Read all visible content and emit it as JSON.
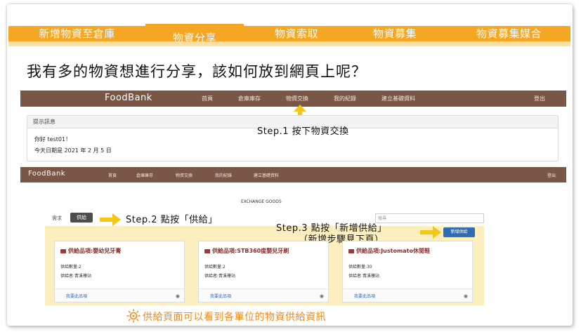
{
  "tabs": [
    {
      "label": "新增物資至倉庫"
    },
    {
      "label": "物資分享"
    },
    {
      "label": "物資索取"
    },
    {
      "label": "物資募集"
    },
    {
      "label": "物資募集媒合"
    }
  ],
  "question": "我有多的物資想進行分享，該如何放到網頁上呢？",
  "screen1": {
    "brand": "FoodBank",
    "nav": [
      "首頁",
      "倉庫庫存",
      "物資交換",
      "我的紀錄",
      "建立基礎資料"
    ],
    "logout": "登出",
    "alert_header": "提示訊息",
    "greeting": "你好 test01！",
    "date_line": "今天日期是 2021 年 2 月 5 日"
  },
  "step1": "Step.1 按下物資交換",
  "screen2": {
    "brand": "FoodBank",
    "nav": [
      "首頁",
      "倉庫庫存",
      "物資交換",
      "我的紀錄",
      "建立基礎資料"
    ],
    "logout": "登出",
    "section_title": "EXCHANGE GOODS",
    "pill_need": "需求",
    "pill_supply": "供給",
    "search_placeholder": "搜尋",
    "add_button": "新增供給",
    "cards": [
      {
        "title": "供給品項:嬰幼兒牙膏",
        "qty": "供給數量:2",
        "provider": "供給者:青溪樓站",
        "want": "我要此品項"
      },
      {
        "title": "供給品項:STB360度嬰兒牙刷",
        "qty": "供給數量:2",
        "provider": "供給者:青溪樓站",
        "want": "我要此品項"
      },
      {
        "title": "供給品項:Justomato休閒鞋",
        "qty": "供給數量:30",
        "provider": "供給者:青溪樓站",
        "want": "我要此品項"
      }
    ]
  },
  "step2": "Step.2 點按「供給」",
  "step3": "Step.3 點按「新增供給」",
  "step3_note": "（新增步驟見下頁）",
  "caption": "供給頁面可以看到各單位的物資供給資訊",
  "colors": {
    "accent": "#f5a623",
    "nav": "#7a5646",
    "caption": "#f08a1c"
  }
}
